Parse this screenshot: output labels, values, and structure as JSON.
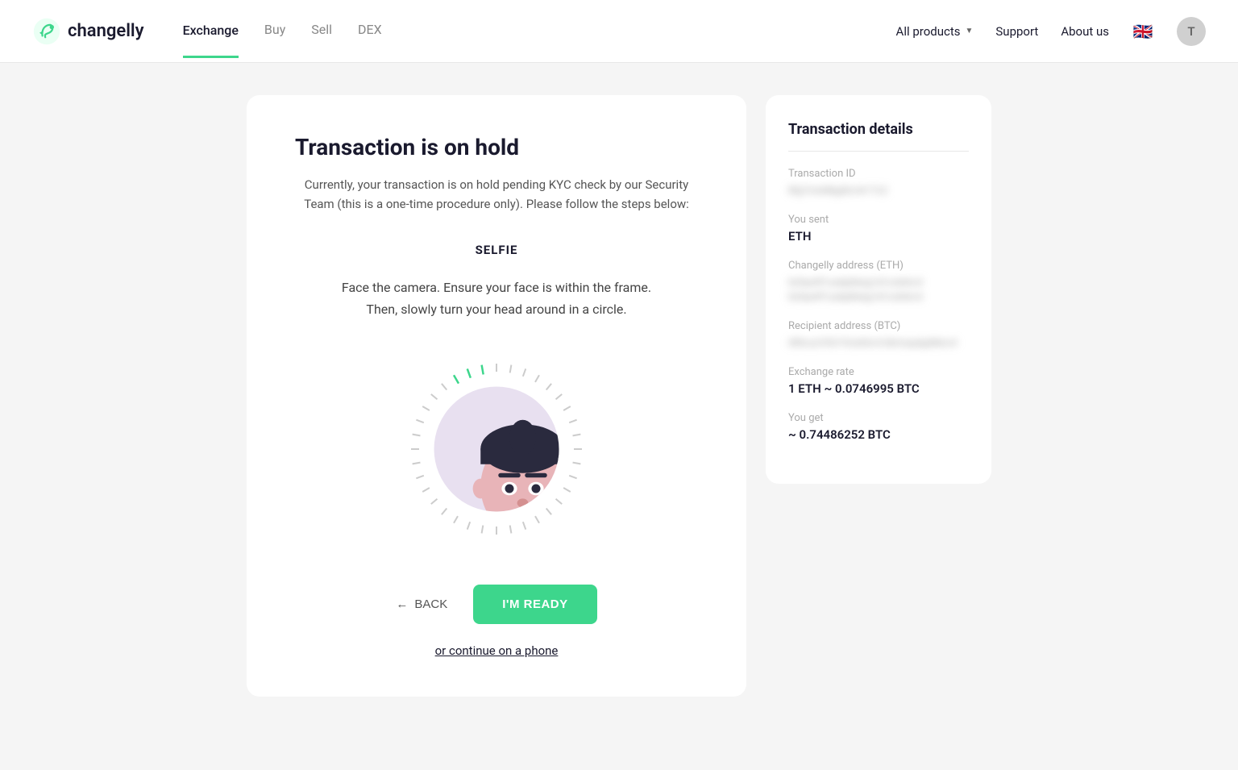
{
  "header": {
    "logo_text": "changelly",
    "nav": {
      "items": [
        {
          "label": "Exchange",
          "active": true
        },
        {
          "label": "Buy",
          "active": false
        },
        {
          "label": "Sell",
          "active": false
        },
        {
          "label": "DEX",
          "active": false
        }
      ]
    },
    "all_products_label": "All products",
    "support_label": "Support",
    "about_label": "About us",
    "user_initial": "T"
  },
  "main_card": {
    "title": "Transaction is on hold",
    "subtitle": "Currently, your transaction is on hold pending KYC check by our Security Team (this is a one-time procedure only). Please follow the steps below:",
    "selfie_label": "SELFIE",
    "selfie_description": "Face the camera. Ensure your face is within the frame. Then, slowly turn your head around in a circle.",
    "back_label": "BACK",
    "ready_label": "I'M READY",
    "phone_link": "or continue on a phone"
  },
  "details_card": {
    "title": "Transaction details",
    "transaction_id_label": "Transaction ID",
    "transaction_id_value": "8fg7rre4dkg6trc4r17c2",
    "you_sent_label": "You sent",
    "you_sent_value": "ETH",
    "changelly_address_label": "Changelly address (ETH)",
    "changelly_address_value": "0x9ye4f1ca4p8Aeg1d1cnb4rc4 0x9ye4f1ca4p8Aeg1d1cnb4rc4",
    "recipient_address_label": "Recipient address (BTC)",
    "recipient_address_value": "rB9cca1K3r1fcnb4rc4 bkrtcaydg4bkrc4",
    "exchange_rate_label": "Exchange rate",
    "exchange_rate_value": "1 ETH ~ 0.0746995 BTC",
    "you_get_label": "You get",
    "you_get_value": "~ 0.74486252 BTC"
  }
}
